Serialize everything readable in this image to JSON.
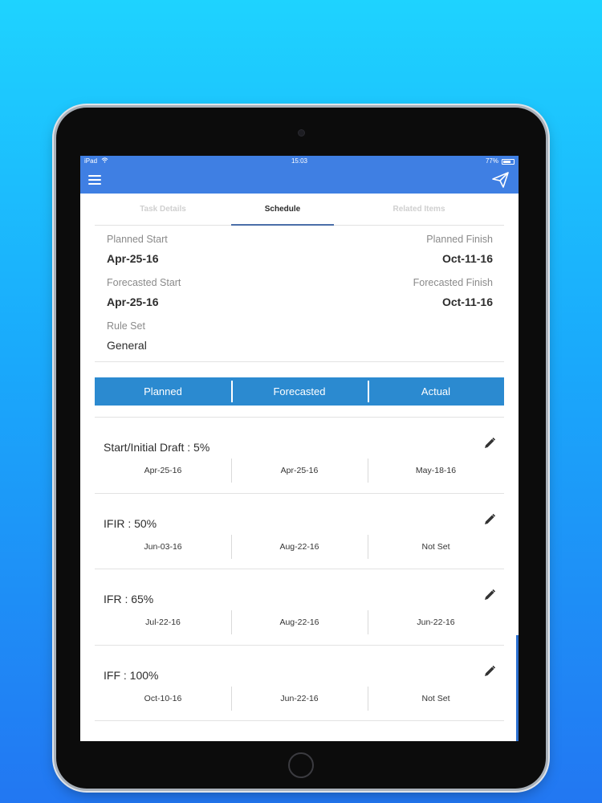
{
  "status_bar": {
    "device": "iPad",
    "time": "15:03",
    "battery": "77%",
    "battery_level": 0.77
  },
  "icons": {
    "menu": "menu-icon",
    "send": "paper-plane-icon",
    "edit": "pencil-icon",
    "wifi": "wifi-icon",
    "battery": "battery-icon"
  },
  "colors": {
    "app_bar": "#3f7fe3",
    "segment": "#2b8ad0",
    "tab_indicator": "#4a6ea8"
  },
  "tabs": [
    {
      "label": "Task Details",
      "active": false
    },
    {
      "label": "Schedule",
      "active": true
    },
    {
      "label": "Related Items",
      "active": false
    }
  ],
  "info": {
    "planned_start_label": "Planned Start",
    "planned_start": "Apr-25-16",
    "planned_finish_label": "Planned Finish",
    "planned_finish": "Oct-11-16",
    "forecasted_start_label": "Forecasted Start",
    "forecasted_start": "Apr-25-16",
    "forecasted_finish_label": "Forecasted Finish",
    "forecasted_finish": "Oct-11-16",
    "rule_set_label": "Rule Set",
    "rule_set": "General"
  },
  "segments": [
    "Planned",
    "Forecasted",
    "Actual"
  ],
  "milestones": [
    {
      "title": "Start/Initial Draft : 5%",
      "planned": "Apr-25-16",
      "forecasted": "Apr-25-16",
      "actual": "May-18-16"
    },
    {
      "title": "IFIR : 50%",
      "planned": "Jun-03-16",
      "forecasted": "Aug-22-16",
      "actual": "Not Set"
    },
    {
      "title": "IFR : 65%",
      "planned": "Jul-22-16",
      "forecasted": "Aug-22-16",
      "actual": "Jun-22-16"
    },
    {
      "title": "IFF : 100%",
      "planned": "Oct-10-16",
      "forecasted": "Jun-22-16",
      "actual": "Not Set"
    }
  ]
}
